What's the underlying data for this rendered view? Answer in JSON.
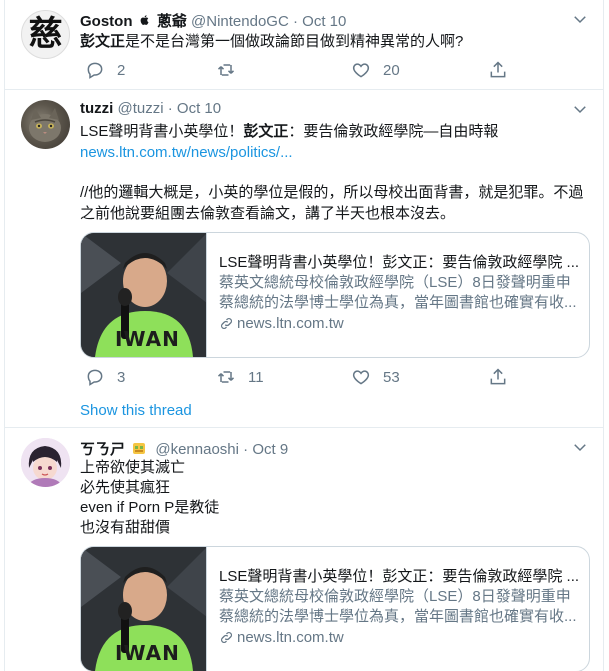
{
  "tweets": [
    {
      "name": "Goston",
      "name_suffix": "蔥爺",
      "handle": "@NintendoGC",
      "date": "Oct 10",
      "text_bold": "彭文正",
      "text": "是不是台灣第一個做政論節目做到精神異常的人啊?",
      "reply_count": "2",
      "retweet_count": "",
      "like_count": "20"
    },
    {
      "name": "tuzzi",
      "handle": "@tuzzi",
      "date": "Oct 10",
      "line1_pre": "LSE聲明背書小英學位！",
      "line1_bold": "彭文正",
      "line1_post": "：要告倫敦政經學院—自由時報",
      "link": "news.ltn.com.tw/news/politics/...",
      "line3": "//他的邏輯大概是，小英的學位是假的，所以母校出面背書，就是犯罪。不過",
      "line4": "之前他說要組團去倫敦查看論文，講了半天也根本沒去。",
      "card_title": "LSE聲明背書小英學位！彭文正：要告倫敦政經學院 ...",
      "card_desc1": "蔡英文總統母校倫敦政經學院（LSE）8日發聲明重申",
      "card_desc2": "蔡總統的法學博士學位為真，當年圖書館也確實有收...",
      "card_domain": "news.ltn.com.tw",
      "reply_count": "3",
      "retweet_count": "11",
      "like_count": "53",
      "show_thread": "Show this thread"
    },
    {
      "name": "ㄎㄋㄕ",
      "handle": "@kennaoshi",
      "date": "Oct 9",
      "lines": [
        "上帝欲使其滅亡",
        "必先使其瘋狂",
        "even if Porn P是教徒",
        "也沒有甜甜價"
      ],
      "card_title": "LSE聲明背書小英學位！彭文正：要告倫敦政經學院 ...",
      "card_desc1": "蔡英文總統母校倫敦政經學院（LSE）8日發聲明重申",
      "card_desc2": "蔡總統的法學博士學位為真，當年圖書館也確實有收...",
      "card_domain": "news.ltn.com.tw"
    }
  ],
  "dot": "·",
  "avatar1_glyph": "慈",
  "card_img_text": "IWAN",
  "colors": {
    "accent": "#1b95e0",
    "secondary": "#657786",
    "border": "#e6ecf0"
  }
}
